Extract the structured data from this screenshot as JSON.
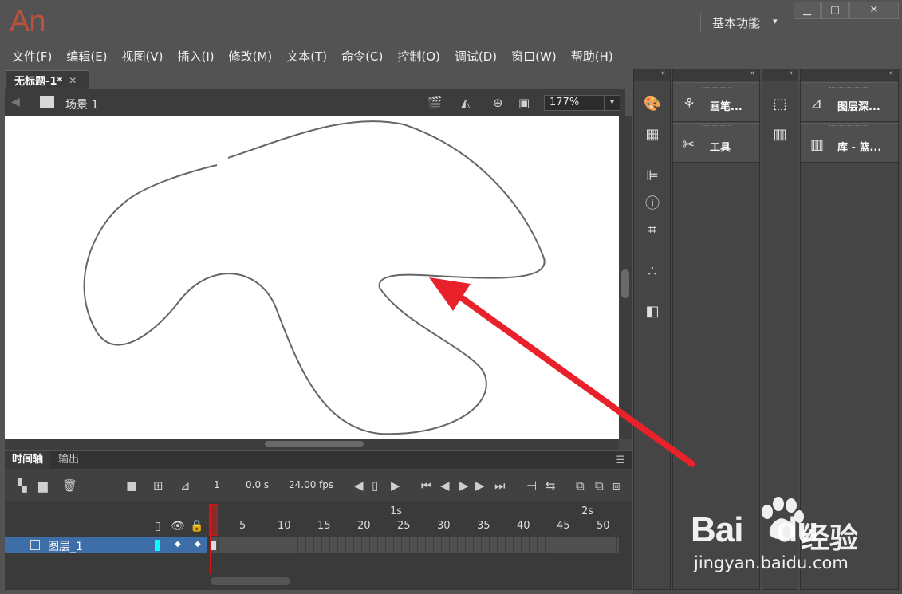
{
  "app": {
    "logo": "An",
    "workspace": "基本功能"
  },
  "window_buttons": {
    "minimize": "▁",
    "maximize": "▢",
    "close": "✕"
  },
  "menu": [
    "文件(F)",
    "编辑(E)",
    "视图(V)",
    "插入(I)",
    "修改(M)",
    "文本(T)",
    "命令(C)",
    "控制(O)",
    "调试(D)",
    "窗口(W)",
    "帮助(H)"
  ],
  "document": {
    "tab_name": "无标题-1*",
    "close_glyph": "✕"
  },
  "scene": {
    "name": "场景 1",
    "zoom": "177%"
  },
  "timeline": {
    "tabs": [
      "时间轴",
      "输出"
    ],
    "current_frame": "1",
    "time": "0.0 s",
    "fps_value": "24.00",
    "fps_unit": "fps",
    "second_markers": [
      "1s",
      "2s"
    ],
    "frame_numbers": [
      "1",
      "5",
      "10",
      "15",
      "20",
      "25",
      "30",
      "35",
      "40",
      "45",
      "50"
    ],
    "layers": [
      {
        "name": "图层_1"
      }
    ]
  },
  "panels": {
    "col3": [
      {
        "label": "画笔...",
        "icon": "brush-icon"
      },
      {
        "label": "工具",
        "icon": "tools-icon"
      }
    ],
    "col5": [
      {
        "label": "图层深...",
        "icon": "layer-depth-icon"
      },
      {
        "label": "库 - 篮...",
        "icon": "library-icon"
      }
    ]
  },
  "stage": {
    "stroke_color": "#666666",
    "arrow_color": "#e8212a"
  },
  "watermark": {
    "brand": "Bai",
    "brand_tail": "du",
    "cn": "经验",
    "url": "jingyan.baidu.com"
  }
}
